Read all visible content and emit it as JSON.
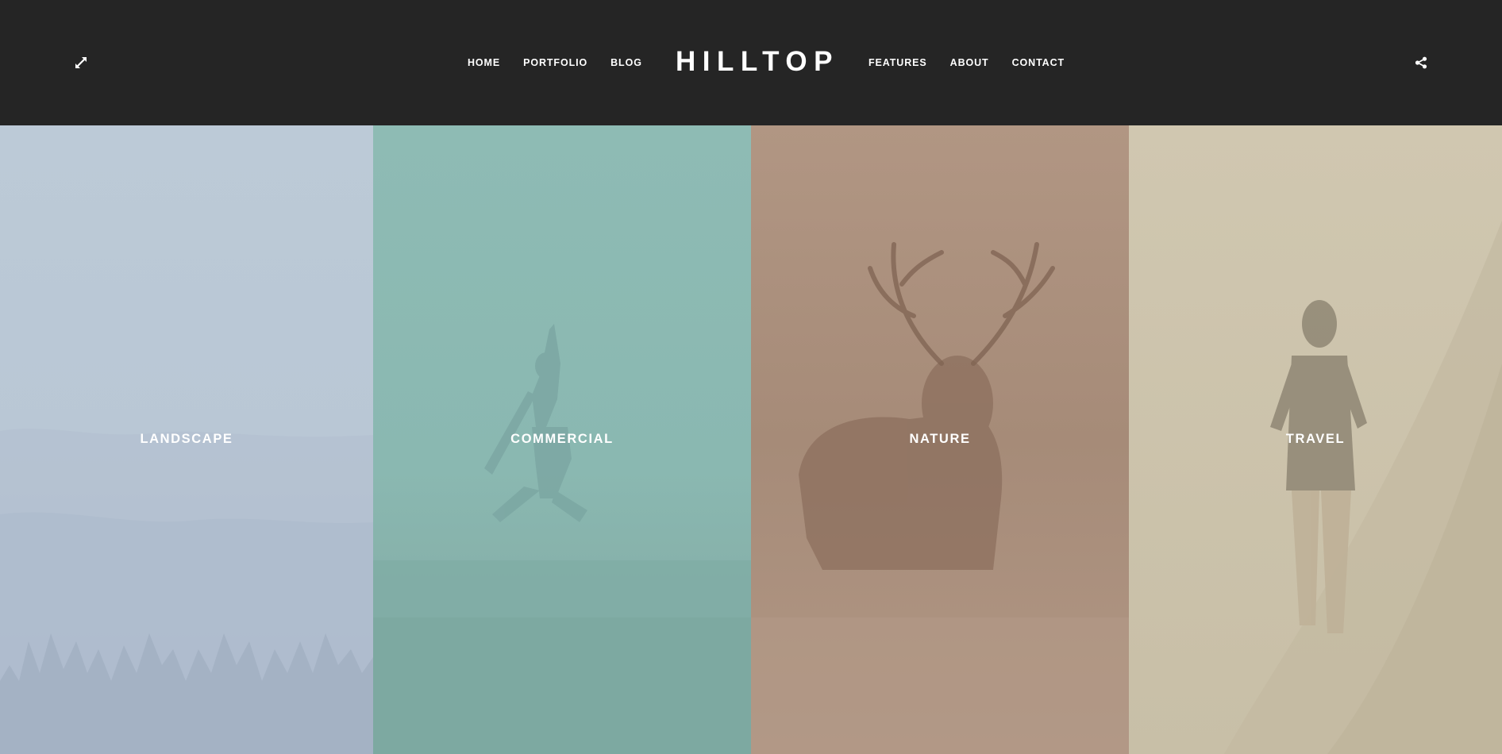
{
  "header": {
    "logo": "HILLTOP",
    "nav_left": [
      {
        "label": "HOME"
      },
      {
        "label": "PORTFOLIO"
      },
      {
        "label": "BLOG"
      }
    ],
    "nav_right": [
      {
        "label": "FEATURES"
      },
      {
        "label": "ABOUT"
      },
      {
        "label": "CONTACT"
      }
    ],
    "left_icon": "expand-icon",
    "right_icon": "share-icon"
  },
  "panels": [
    {
      "label": "LANDSCAPE",
      "tint": "#b8c6d4"
    },
    {
      "label": "COMMERCIAL",
      "tint": "#8bbab3"
    },
    {
      "label": "NATURE",
      "tint": "#ad9280"
    },
    {
      "label": "TRAVEL",
      "tint": "#cdc4ad"
    }
  ]
}
